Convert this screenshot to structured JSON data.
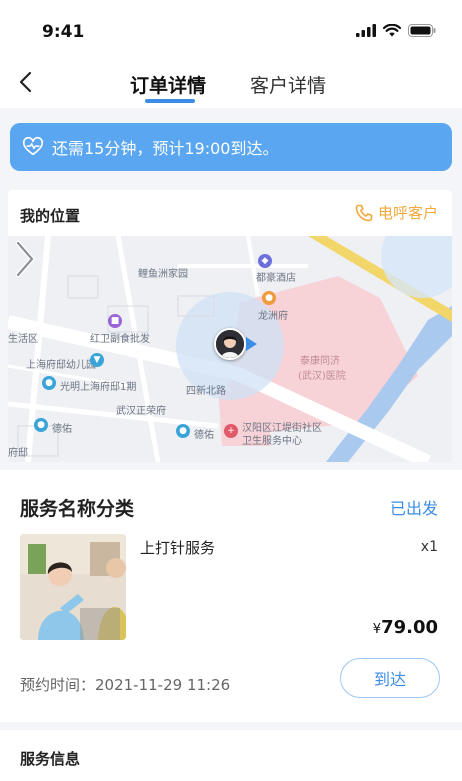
{
  "status_bar": {
    "time": "9:41"
  },
  "nav": {
    "tabs": [
      {
        "label": "订单详情",
        "active": true
      },
      {
        "label": "客户详情",
        "active": false
      }
    ]
  },
  "notice": {
    "text": "还需15分钟，预计19:00到达。"
  },
  "location": {
    "title": "我的位置",
    "call_label": "电呼客户",
    "map_labels": {
      "community": "鲤鱼洲家园",
      "hotel": "都豪酒店",
      "longzhou": "龙洲府",
      "hongwei": "红卫副食批发",
      "health_station": "生活区",
      "kindergarten": "上海府邸幼儿园",
      "guangming": "光明上海府邸1期",
      "hospital_1": "泰康同济",
      "hospital_2": "(武汉)医院",
      "road": "四新北路",
      "desheng_1": "德佑",
      "desheng_2": "德佑",
      "wuhan_home": "武汉正荣府",
      "health_center_1": "汉阳区江堤街社区",
      "health_center_2": "卫生服务中心",
      "fudi": "府邸"
    }
  },
  "service": {
    "title": "服务名称分类",
    "status": "已出发",
    "item_name": "上打针服务",
    "quantity": "x1",
    "currency": "¥",
    "price": "79.00",
    "appointment": "预约时间：2021-11-29 11:26",
    "arrive_label": "到达"
  },
  "info": {
    "title": "服务信息"
  },
  "colors": {
    "accent": "#3d8de6",
    "notice_bg": "#5aa6f0",
    "call": "#f2a83b"
  }
}
